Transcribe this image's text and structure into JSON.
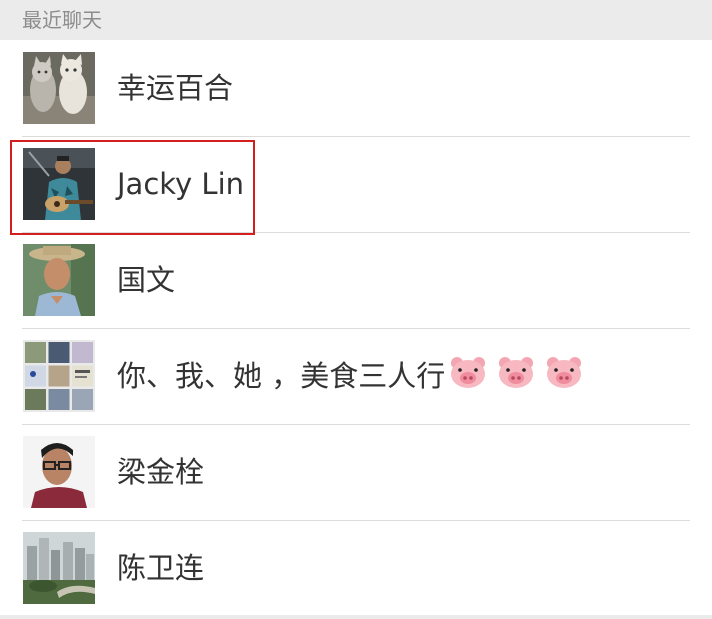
{
  "section": {
    "title": "最近聊天"
  },
  "chats": [
    {
      "name": "幸运百合",
      "avatar": "cats-photo-avatar"
    },
    {
      "name": "Jacky Lin",
      "avatar": "guitarist-photo-avatar",
      "highlighted": true
    },
    {
      "name": "国文",
      "avatar": "man-hat-photo-avatar"
    },
    {
      "name": "你、我、她 ，美食三人行",
      "emoji_suffix": [
        "pig-face-icon",
        "pig-face-icon",
        "pig-face-icon"
      ],
      "avatar": "group-grid-avatar"
    },
    {
      "name": "梁金栓",
      "avatar": "man-glasses-photo-avatar"
    },
    {
      "name": "陈卫连",
      "avatar": "city-buildings-photo-avatar"
    }
  ],
  "colors": {
    "highlight": "#d51f1f",
    "header_bg": "#ebebeb",
    "divider": "#dcdcdc"
  }
}
